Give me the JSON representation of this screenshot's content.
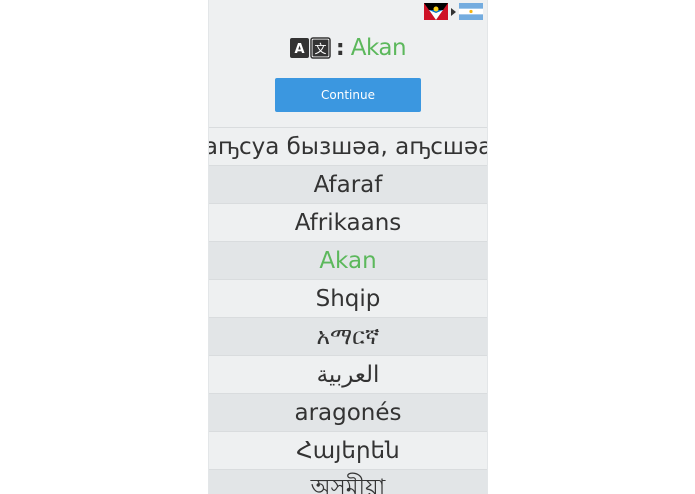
{
  "header": {
    "separator": ":",
    "selected_language": "Akan"
  },
  "flags": [
    {
      "icon": "antigua-flag-icon"
    },
    {
      "icon": "argentina-flag-icon"
    }
  ],
  "continue_label": "Continue",
  "languages": [
    {
      "label": "аҧсуа бызшәа, аҧсшәа"
    },
    {
      "label": "Afaraf"
    },
    {
      "label": "Afrikaans"
    },
    {
      "label": "Akan"
    },
    {
      "label": "Shqip"
    },
    {
      "label": "አማርኛ"
    },
    {
      "label": "العربية"
    },
    {
      "label": "aragonés"
    },
    {
      "label": "Հայերեն"
    },
    {
      "label": "অসমীয়া"
    }
  ],
  "colors": {
    "accent_green": "#5cb85c",
    "button_blue": "#3b97e0"
  }
}
